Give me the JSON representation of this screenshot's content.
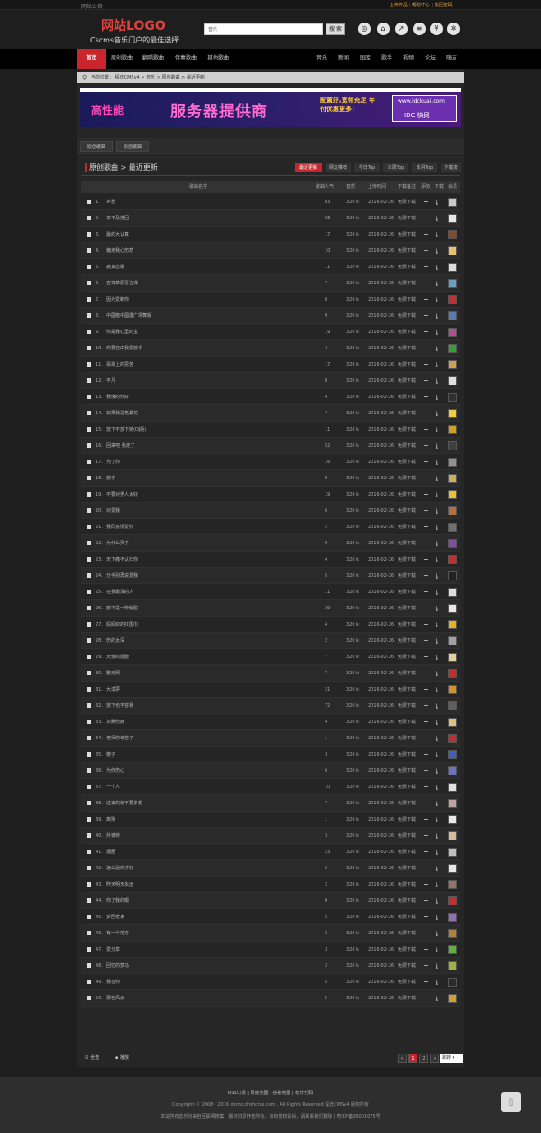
{
  "topbar": {
    "notice": "网站公告",
    "links": [
      "上传作品",
      "帮助中心",
      "找回密码"
    ],
    "sep": "|"
  },
  "header": {
    "logo": "网站LOGO",
    "slogan": "Cscms音乐门户的最佳选择",
    "search_value": "音乐",
    "search_btn": "搜 索",
    "icons": [
      "music-disc-icon",
      "home-icon",
      "share-icon",
      "rss-icon",
      "yen-icon",
      "settings-icon"
    ]
  },
  "nav": {
    "items": [
      "首页",
      "原创歌曲",
      "翻唱歌曲",
      "伴奏歌曲",
      "其他歌曲",
      "音乐",
      "新闻",
      "图库",
      "歌手",
      "视频",
      "论坛",
      "嗨友"
    ]
  },
  "breadcrumb": {
    "label": "当前位置：",
    "crumbs": [
      "程氏CMSv4",
      "音乐",
      "原创歌曲",
      "最近更新"
    ],
    "sep": ">"
  },
  "banner": {
    "line1": "高性能",
    "line2": "服务器提供商",
    "line3": "配置好,宽带充足 年付优惠更多!",
    "domain": "www.idckuai.com",
    "brand": "IDC 快网"
  },
  "subtabs": [
    "原创歌曲",
    "原创歌曲"
  ],
  "list": {
    "title": "原创歌曲 > 最近更新",
    "tabs": [
      "最近更新",
      "网友推荐",
      "今日Top",
      "本周Top",
      "本月Top",
      "下载榜"
    ]
  },
  "table": {
    "headers": [
      "歌曲名字",
      "歌曲人气",
      "音质",
      "上传时间",
      "下载备注",
      "添加",
      "下载",
      "会员"
    ],
    "rows": [
      {
        "n": "1.",
        "t": "乡愁",
        "p": "83",
        "q": "320 k",
        "d": "2016-02-26",
        "r": "免费下载"
      },
      {
        "n": "2.",
        "t": "来不及挽回",
        "p": "58",
        "q": "320 k",
        "d": "2016-02-26",
        "r": "免费下载"
      },
      {
        "n": "3.",
        "t": "最的大认真",
        "p": "17",
        "q": "320 k",
        "d": "2016-02-26",
        "r": "免费下载"
      },
      {
        "n": "4.",
        "t": "偏走我心伤悲",
        "p": "10",
        "q": "320 k",
        "d": "2016-02-26",
        "r": "免费下载"
      },
      {
        "n": "5.",
        "t": "寂寞恋歌",
        "p": "11",
        "q": "320 k",
        "d": "2016-02-26",
        "r": "免费下载"
      },
      {
        "n": "6.",
        "t": "吉祥草原喜言洋",
        "p": "7",
        "q": "320 k",
        "d": "2016-02-26",
        "r": "免费下载"
      },
      {
        "n": "7.",
        "t": "因为爱断你",
        "p": "8",
        "q": "320 k",
        "d": "2016-02-26",
        "r": "免费下载"
      },
      {
        "n": "8.",
        "t": "中國龍中國護广场舞版",
        "p": "9",
        "q": "320 k",
        "d": "2016-02-26",
        "r": "免费下载"
      },
      {
        "n": "9.",
        "t": "你是我心里的宝",
        "p": "19",
        "q": "320 k",
        "d": "2016-02-26",
        "r": "免费下载"
      },
      {
        "n": "10.",
        "t": "你要自由我爱放手",
        "p": "4",
        "q": "320 k",
        "d": "2016-02-26",
        "r": "免费下载"
      },
      {
        "n": "11.",
        "t": "翡翠上的思苦",
        "p": "17",
        "q": "320 k",
        "d": "2016-02-26",
        "r": "免费下载"
      },
      {
        "n": "12.",
        "t": "平凡",
        "p": "8",
        "q": "320 k",
        "d": "2016-02-26",
        "r": "免费下载"
      },
      {
        "n": "13.",
        "t": "我懂的你好",
        "p": "4",
        "q": "320 k",
        "d": "2016-02-26",
        "r": "免费下载"
      },
      {
        "n": "14.",
        "t": "如果我是格桑花",
        "p": "7",
        "q": "320 k",
        "d": "2016-02-26",
        "r": "免费下载"
      },
      {
        "n": "15.",
        "t": "放下不放下她(DJ版)",
        "p": "11",
        "q": "320 k",
        "d": "2016-02-26",
        "r": "免费下载"
      },
      {
        "n": "16.",
        "t": "回来吧 我走了",
        "p": "52",
        "q": "320 k",
        "d": "2016-02-26",
        "r": "免费下载"
      },
      {
        "n": "17.",
        "t": "为了你",
        "p": "16",
        "q": "320 k",
        "d": "2016-02-26",
        "r": "免费下载"
      },
      {
        "n": "18.",
        "t": "放手",
        "p": "9",
        "q": "320 k",
        "d": "2016-02-26",
        "r": "免费下载"
      },
      {
        "n": "19.",
        "t": "不要对男人太好",
        "p": "19",
        "q": "320 k",
        "d": "2016-02-26",
        "r": "免费下载"
      },
      {
        "n": "20.",
        "t": "对爱我",
        "p": "6",
        "q": "320 k",
        "d": "2016-02-26",
        "r": "免费下载"
      },
      {
        "n": "21.",
        "t": "我同意情爱你",
        "p": "2",
        "q": "320 k",
        "d": "2016-02-26",
        "r": "免费下载"
      },
      {
        "n": "22.",
        "t": "为什么哭了",
        "p": "9",
        "q": "320 k",
        "d": "2016-02-26",
        "r": "免费下载"
      },
      {
        "n": "23.",
        "t": "天下痛不认归你",
        "p": "4",
        "q": "320 k",
        "d": "2016-02-26",
        "r": "免费下载"
      },
      {
        "n": "24.",
        "t": "分手别再说爱我",
        "p": "5",
        "q": "320 k",
        "d": "2016-02-26",
        "r": "免费下载"
      },
      {
        "n": "25.",
        "t": "在我最深的人",
        "p": "11",
        "q": "320 k",
        "d": "2016-02-26",
        "r": "免费下载"
      },
      {
        "n": "26.",
        "t": "放下是一种解脱",
        "p": "39",
        "q": "320 k",
        "d": "2016-02-26",
        "r": "免费下载"
      },
      {
        "n": "27.",
        "t": "妈妈织的红围巾",
        "p": "4",
        "q": "320 k",
        "d": "2016-02-26",
        "r": "免费下载"
      },
      {
        "n": "28.",
        "t": "伤的太深",
        "p": "2",
        "q": "320 k",
        "d": "2016-02-26",
        "r": "免费下载"
      },
      {
        "n": "29.",
        "t": "天使的翅膀",
        "p": "7",
        "q": "320 k",
        "d": "2016-02-26",
        "r": "免费下载"
      },
      {
        "n": "30.",
        "t": "繁无网",
        "p": "7",
        "q": "320 k",
        "d": "2016-02-26",
        "r": "免费下载"
      },
      {
        "n": "31.",
        "t": "大漠夢",
        "p": "21",
        "q": "320 k",
        "d": "2016-02-26",
        "r": "免费下载"
      },
      {
        "n": "32.",
        "t": "放下也不容易",
        "p": "72",
        "q": "320 k",
        "d": "2016-02-26",
        "r": "免费下载"
      },
      {
        "n": "33.",
        "t": "灰腾伤痛",
        "p": "4",
        "q": "320 k",
        "d": "2016-02-26",
        "r": "免费下载"
      },
      {
        "n": "34.",
        "t": "老师你辛苦了",
        "p": "1",
        "q": "320 k",
        "d": "2016-02-26",
        "r": "免费下载"
      },
      {
        "n": "35.",
        "t": "傻子",
        "p": "3",
        "q": "320 k",
        "d": "2016-02-26",
        "r": "免费下载"
      },
      {
        "n": "36.",
        "t": "为你伤心",
        "p": "6",
        "q": "320 k",
        "d": "2016-02-26",
        "r": "免费下载"
      },
      {
        "n": "37.",
        "t": "一个人",
        "p": "10",
        "q": "320 k",
        "d": "2016-02-26",
        "r": "免费下载"
      },
      {
        "n": "38.",
        "t": "过去的就不要多想",
        "p": "7",
        "q": "320 k",
        "d": "2016-02-26",
        "r": "免费下载"
      },
      {
        "n": "39.",
        "t": "离殇",
        "p": "1",
        "q": "320 k",
        "d": "2016-02-26",
        "r": "免费下载"
      },
      {
        "n": "40.",
        "t": "外婆桥",
        "p": "3",
        "q": "320 k",
        "d": "2016-02-26",
        "r": "免费下载"
      },
      {
        "n": "41.",
        "t": "烟圈",
        "p": "23",
        "q": "320 k",
        "d": "2016-02-26",
        "r": "免费下载"
      },
      {
        "n": "42.",
        "t": "怎么說你才好",
        "p": "6",
        "q": "320 k",
        "d": "2016-02-26",
        "r": "免费下载"
      },
      {
        "n": "43.",
        "t": "昨天明天永远",
        "p": "2",
        "q": "320 k",
        "d": "2016-02-26",
        "r": "免费下载"
      },
      {
        "n": "44.",
        "t": "你了我的眼",
        "p": "0",
        "q": "320 k",
        "d": "2016-02-26",
        "r": "免费下载"
      },
      {
        "n": "45.",
        "t": "梦回老家",
        "p": "5",
        "q": "320 k",
        "d": "2016-02-26",
        "r": "免费下载"
      },
      {
        "n": "46.",
        "t": "有一个地方",
        "p": "2",
        "q": "320 k",
        "d": "2016-02-26",
        "r": "免费下载"
      },
      {
        "n": "47.",
        "t": "爱分享",
        "p": "3",
        "q": "320 k",
        "d": "2016-02-26",
        "r": "免费下载"
      },
      {
        "n": "48.",
        "t": "回忆的梦马",
        "p": "3",
        "q": "320 k",
        "d": "2016-02-26",
        "r": "免费下载"
      },
      {
        "n": "49.",
        "t": "我在你",
        "p": "5",
        "q": "320 k",
        "d": "2016-02-26",
        "r": "免费下载"
      },
      {
        "n": "50.",
        "t": "那色风云",
        "p": "5",
        "q": "320 k",
        "d": "2016-02-26",
        "r": "免费下载"
      }
    ],
    "avatar_colors": [
      "#c9c9c9",
      "#e8e8e8",
      "#8a4a2a",
      "#e7c070",
      "#dcdcdc",
      "#6aa0c0",
      "#c03030",
      "#5a7ab0",
      "#b05090",
      "#38a038",
      "#d0a050",
      "#e0e0e0",
      "#303030",
      "#f0d040",
      "#d0a020",
      "#404040",
      "#909090",
      "#c8b060",
      "#e8c030",
      "#b07040",
      "#707070",
      "#8050a0",
      "#c03030",
      "#222222",
      "#dddddd",
      "#e8e8e8",
      "#e8b020",
      "#a0a0a0",
      "#e0d0a0",
      "#c03030",
      "#d09030",
      "#606060",
      "#e0c080",
      "#c03030",
      "#4060c0",
      "#7070c0",
      "#e0e0e0",
      "#c0a0a0",
      "#e8e8e8",
      "#d0c0a0",
      "#c0c0c0",
      "#e8e8e8",
      "#9a7060",
      "#c03030",
      "#9070b0",
      "#b08040",
      "#60b040",
      "#a0b040",
      "#2a2a2a",
      "#d0a030"
    ]
  },
  "footer": {
    "select_all": "全选",
    "play": "播放",
    "pages": [
      "1",
      "2"
    ],
    "sort_label": "跳转",
    "links": "RSS订阅 | 百度地图 | 谷歌地图 | 统计代码",
    "copyright": "Copyright © 2008 - 2016 demo.chshcms.com , All Rights Reserved 程氏CMSv4 版权所有",
    "note": "本站所有音乐均来自互联网搜集，版权归原作者所有，如有侵权投诉，请联系我们删除 | 粤ICP备06001075号"
  },
  "colors": {
    "accent": "#c8262c",
    "logo": "#e0423a",
    "link": "#e8a33a"
  }
}
